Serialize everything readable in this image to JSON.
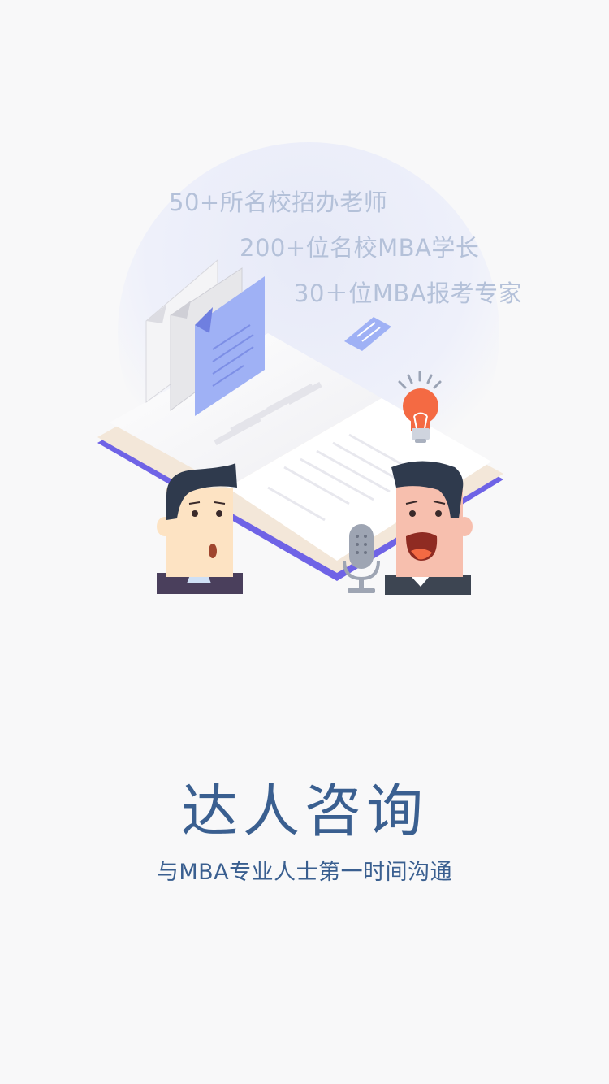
{
  "onboarding": {
    "stats": [
      "50+所名校招办老师",
      "200+位名校MBA学长",
      "30＋位MBA报考专家"
    ],
    "title": "达人咨询",
    "subtitle": "与MBA专业人士第一时间沟通"
  },
  "colors": {
    "background": "#f8f8f9",
    "title_text": "#3a5f90",
    "stat_text": "#b4c1d9",
    "accent_purple": "#6f63e6",
    "accent_blue": "#9fb1f5",
    "bulb_orange": "#f46a43"
  },
  "icons": {
    "bulb": "lightbulb-icon",
    "microphone": "microphone-icon",
    "document": "document-icon"
  }
}
